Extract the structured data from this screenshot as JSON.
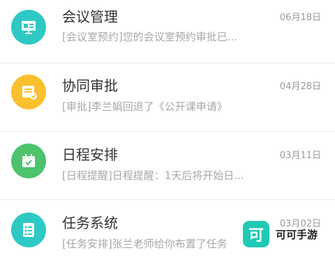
{
  "items": [
    {
      "title": "会议管理",
      "date": "06月18日",
      "preview": "[会议室预约]您的会议室预约审批已...",
      "icon": "presentation-board-icon",
      "color": "#2ec9c4"
    },
    {
      "title": "协同审批",
      "date": "04月28日",
      "preview": "[审批]李兰娟回退了《公开课申请》",
      "icon": "document-approval-icon",
      "color": "#fbc02d"
    },
    {
      "title": "日程安排",
      "date": "03月11日",
      "preview": "[日程提醒]日程提醒：1天后将开始日...",
      "icon": "calendar-check-icon",
      "color": "#4dc36c"
    },
    {
      "title": "任务系统",
      "date": "03月02日",
      "preview": "[任务安排]张兰老师给你布置了任务",
      "icon": "task-list-icon",
      "color": "#2ec9c4"
    }
  ],
  "watermark": {
    "logo_char": "可",
    "text": "可可手游",
    "color": "#1fc9b4"
  }
}
